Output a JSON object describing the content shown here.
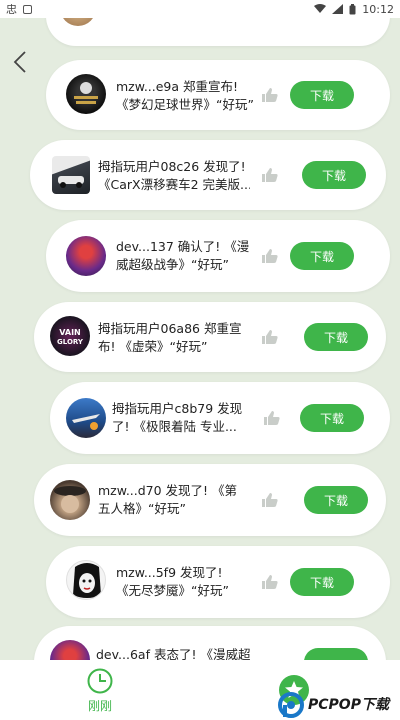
{
  "status_bar": {
    "time": "10:12",
    "carrier_glyph": "忠"
  },
  "colors": {
    "accent": "#3fb54a",
    "background": "#e4ecdf",
    "card": "#ffffff",
    "thumb": "#c9cdc9"
  },
  "feed": [
    {
      "line1": "mzw...e9a 郑重宣布!",
      "line2": "《梦幻足球世界》“好玩”",
      "button": "下载",
      "avatar_icon": "soccer-manager-game-icon"
    },
    {
      "line1": "拇指玩用户08c26 发现了!",
      "line2": "《CarX漂移赛车2 完美版...",
      "button": "下载",
      "avatar_icon": "carx-drift-game-icon"
    },
    {
      "line1": "dev...137 确认了! 《漫",
      "line2": "威超级战争》“好玩”",
      "button": "下载",
      "avatar_icon": "marvel-hero-game-icon"
    },
    {
      "line1": "拇指玩用户06a86 郑重宣",
      "line2": "布! 《虚荣》“好玩”",
      "button": "下载",
      "avatar_icon": "vainglory-game-icon"
    },
    {
      "line1": "拇指玩用户c8b79 发现",
      "line2": "了! 《极限着陆 专业...",
      "button": "下载",
      "avatar_icon": "extreme-landing-game-icon"
    },
    {
      "line1": "mzw...d70 发现了! 《第",
      "line2": "五人格》“好玩”",
      "button": "下载",
      "avatar_icon": "identity-v-game-icon"
    },
    {
      "line1": "mzw...5f9 发现了!",
      "line2": "《无尽梦魇》“好玩”",
      "button": "下载",
      "avatar_icon": "endless-nightmare-game-icon"
    },
    {
      "line1": "dev...6af 表态了! 《漫威超",
      "line2": "",
      "button": "",
      "avatar_icon": "marvel-hero-game-icon"
    }
  ],
  "bottom_nav": {
    "recent_label": "刚刚",
    "star_icon": "star-icon"
  },
  "watermark": {
    "text": "PCPOP下载"
  }
}
